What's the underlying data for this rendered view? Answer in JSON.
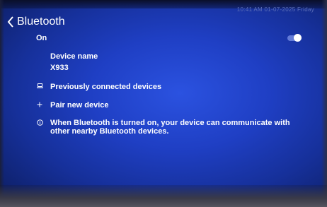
{
  "status_bar": {
    "text": "10:41 AM  01-07-2025  Friday"
  },
  "header": {
    "title": "Bluetooth"
  },
  "toggle": {
    "label": "On",
    "state": "on"
  },
  "device": {
    "label": "Device name",
    "value": "X933"
  },
  "items": [
    {
      "label": "Previously connected devices",
      "icon": "laptop-icon"
    },
    {
      "label": "Pair new device",
      "icon": "plus-icon"
    }
  ],
  "info": {
    "text": "When Bluetooth is turned on, your device can communicate with other nearby Bluetooth devices.",
    "icon": "info-icon"
  },
  "colors": {
    "accent": "#ffffff",
    "background": "#1f3fc4"
  }
}
